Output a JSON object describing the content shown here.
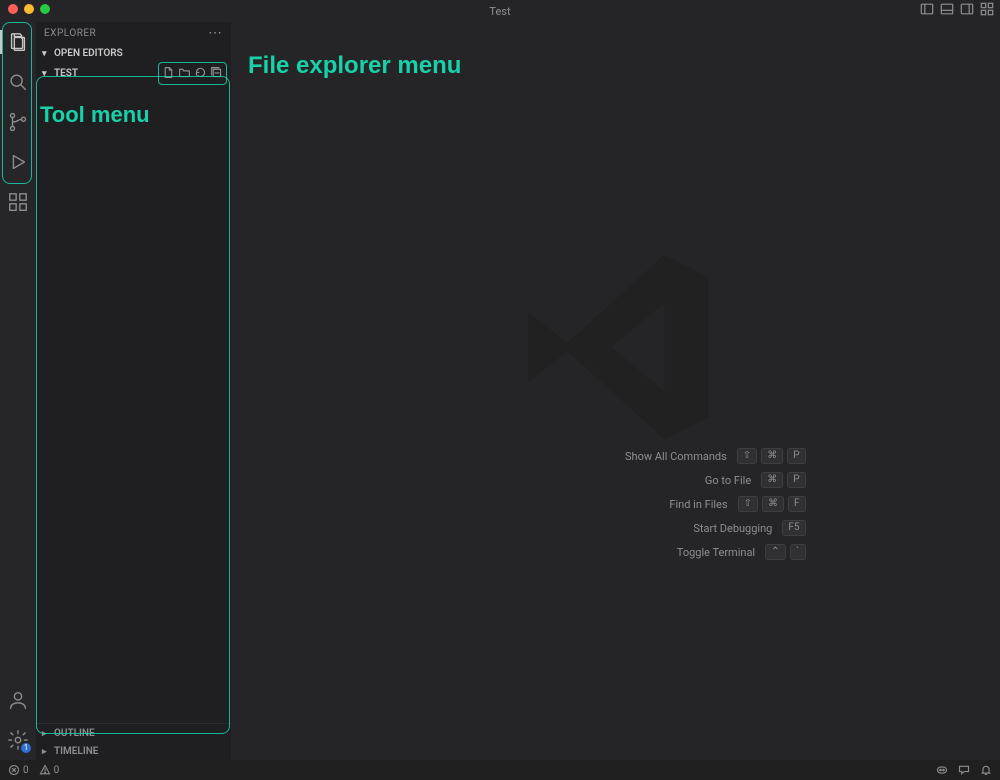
{
  "window": {
    "title": "Test"
  },
  "titlebar_icons": [
    "layout-sidebar-left-icon",
    "layout-panel-icon",
    "layout-sidebar-right-icon",
    "customize-layout-icon"
  ],
  "activity": {
    "top": [
      {
        "name": "explorer-icon",
        "active": true
      },
      {
        "name": "search-icon",
        "active": false
      },
      {
        "name": "source-control-icon",
        "active": false
      },
      {
        "name": "run-debug-icon",
        "active": false
      },
      {
        "name": "extensions-icon",
        "active": false
      }
    ],
    "bottom": [
      {
        "name": "account-icon"
      },
      {
        "name": "settings-gear-icon",
        "badge": "1"
      }
    ]
  },
  "explorer": {
    "title": "EXPLORER",
    "sections": {
      "open_editors": "OPEN EDITORS",
      "folder": "TEST",
      "outline": "OUTLINE",
      "timeline": "TIMELINE"
    },
    "folder_actions": [
      "new-file-icon",
      "new-folder-icon",
      "refresh-icon",
      "collapse-all-icon"
    ]
  },
  "welcome": {
    "commands": [
      {
        "label": "Show All Commands",
        "keys": [
          "⇧",
          "⌘",
          "P"
        ]
      },
      {
        "label": "Go to File",
        "keys": [
          "⌘",
          "P"
        ]
      },
      {
        "label": "Find in Files",
        "keys": [
          "⇧",
          "⌘",
          "F"
        ]
      },
      {
        "label": "Start Debugging",
        "keys": [
          "F5"
        ]
      },
      {
        "label": "Toggle Terminal",
        "keys": [
          "⌃",
          "`"
        ]
      }
    ]
  },
  "status": {
    "errors": "0",
    "warnings": "0"
  },
  "annotations": {
    "tool_menu": "Tool menu",
    "file_explorer_menu": "File explorer menu"
  }
}
